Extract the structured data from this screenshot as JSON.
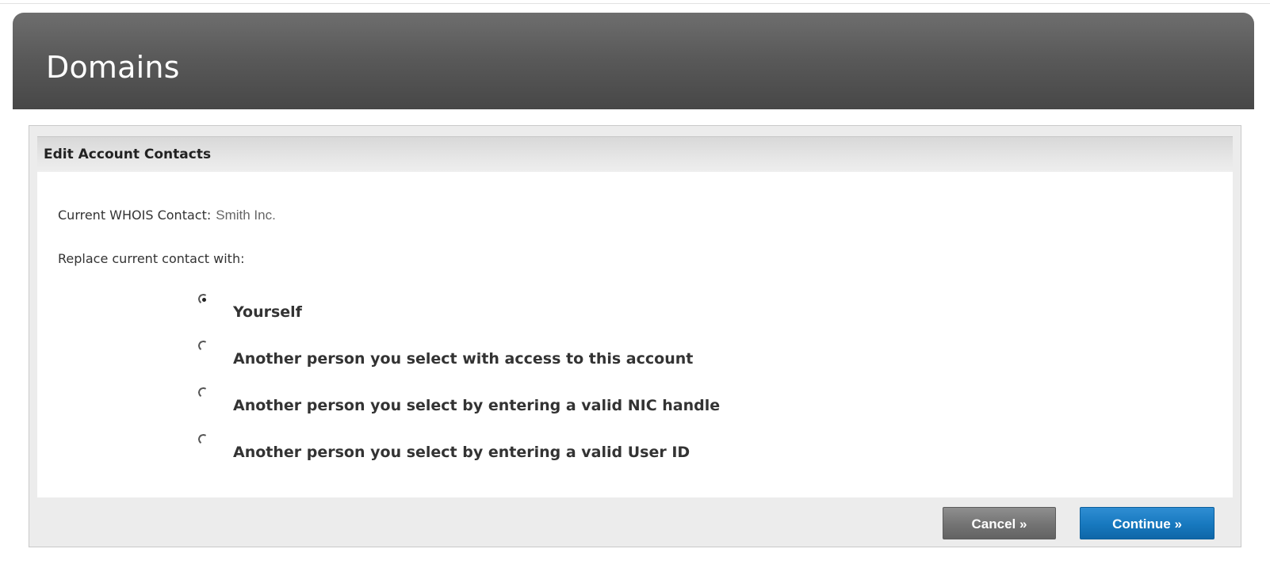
{
  "header": {
    "title": "Domains"
  },
  "panel": {
    "title": "Edit Account Contacts",
    "current_contact_label": "Current WHOIS Contact:",
    "current_contact_value": "Smith Inc.",
    "replace_label": "Replace current contact with:",
    "options": [
      {
        "label": "Yourself",
        "selected": true
      },
      {
        "label": "Another person you select with access to this account",
        "selected": false
      },
      {
        "label": "Another person you select by entering a valid NIC handle",
        "selected": false
      },
      {
        "label": "Another person you select by entering a valid User ID",
        "selected": false
      }
    ],
    "buttons": {
      "cancel_label": "Cancel »",
      "continue_label": "Continue »"
    }
  },
  "colors": {
    "header_bar": "#5a5a5a",
    "cancel_button": "#737373",
    "continue_button": "#1778be"
  }
}
